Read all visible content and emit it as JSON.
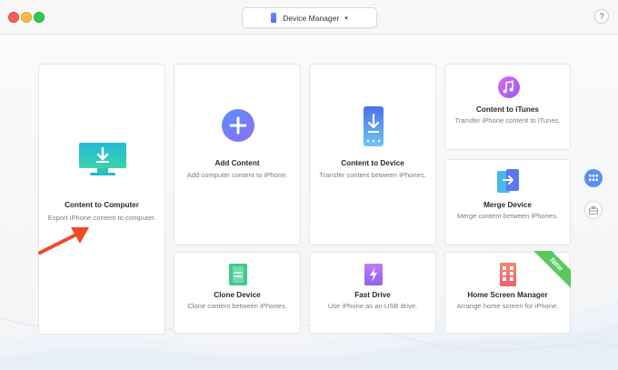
{
  "window": {
    "device_selector": {
      "label": "Device Manager",
      "icon": "phone-icon"
    },
    "help_label": "?"
  },
  "cards": {
    "content_to_computer": {
      "title": "Content to Computer",
      "desc": "Export iPhone content to computer.",
      "icon": "monitor-download-icon"
    },
    "add_content": {
      "title": "Add Content",
      "desc": "Add computer content to iPhone.",
      "icon": "plus-circle-icon"
    },
    "content_to_device": {
      "title": "Content to Device",
      "desc": "Transfer content between iPhones.",
      "icon": "phone-transfer-icon"
    },
    "content_to_itunes": {
      "title": "Content to iTunes",
      "desc": "Transfer iPhone content to iTunes.",
      "icon": "itunes-icon"
    },
    "merge_device": {
      "title": "Merge Device",
      "desc": "Merge content between iPhones.",
      "icon": "merge-device-icon"
    },
    "clone_device": {
      "title": "Clone Device",
      "desc": "Clone content between iPhones.",
      "icon": "clone-device-icon"
    },
    "fast_drive": {
      "title": "Fast Drive",
      "desc": "Use iPhone as an USB drive.",
      "icon": "fast-drive-icon"
    },
    "home_screen_manager": {
      "title": "Home Screen Manager",
      "desc": "Arrange home screen for iPhone.",
      "icon": "home-screen-icon",
      "badge": "New"
    }
  },
  "colors": {
    "accent_blue": "#5b8ff7",
    "badge_green": "#5bc85f",
    "arrow_red": "#f04a26"
  }
}
